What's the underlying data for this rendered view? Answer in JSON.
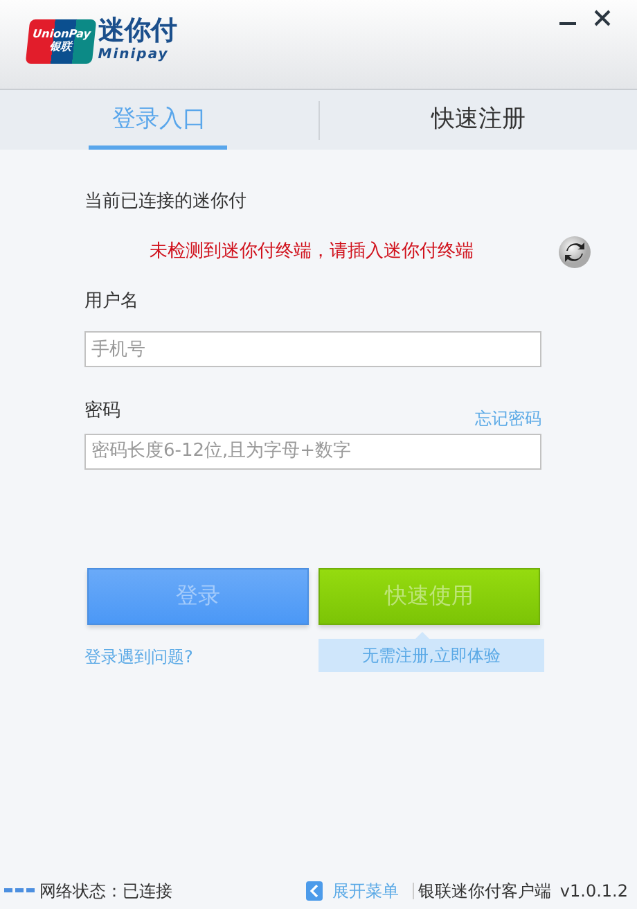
{
  "window": {
    "logo": {
      "card_top": "UnionPay",
      "card_bottom": "银联",
      "title": "迷你付",
      "subtitle": "Minipay"
    }
  },
  "tabs": [
    {
      "label": "登录入口",
      "selected": true
    },
    {
      "label": "快速注册",
      "selected": false
    }
  ],
  "device": {
    "label": "当前已连接的迷你付",
    "message": "未检测到迷你付终端，请插入迷你付终端"
  },
  "form": {
    "username": {
      "label": "用户名",
      "placeholder": "手机号"
    },
    "password": {
      "label": "密码",
      "forgot": "忘记密码",
      "placeholder": "密码长度6-12位,且为字母+数字"
    }
  },
  "buttons": [
    {
      "label": "登录",
      "kind": "login",
      "disabled": true
    },
    {
      "label": "快速使用",
      "kind": "quick",
      "disabled": true
    }
  ],
  "help_link": "登录遇到问题?",
  "tip": "无需注册,立即体验",
  "status_bar": {
    "network": "网络状态：已连接",
    "expand_menu": "展开菜单",
    "app_name": "银联迷你付客户端",
    "version": "v1.0.1.2"
  }
}
